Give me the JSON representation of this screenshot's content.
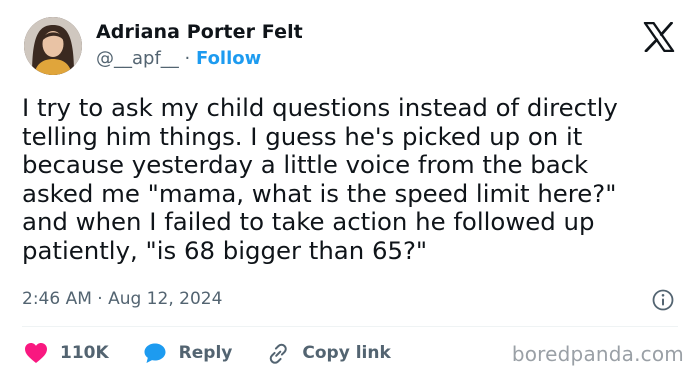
{
  "author": {
    "name": "Adriana Porter Felt",
    "handle": "@__apf__",
    "separator": "·",
    "follow_label": "Follow"
  },
  "tweet": {
    "text": "I try to ask my child questions instead of directly\ntelling him things. I guess he's picked up on it\nbecause yesterday a little voice from the back\nasked me \"mama, what is the speed limit here?\"\nand when I failed to take action he followed up\npatiently, \"is 68 bigger than 65?\"",
    "timestamp": "2:46 AM · Aug 12, 2024"
  },
  "actions": {
    "likes": "110K",
    "reply_label": "Reply",
    "copy_link_label": "Copy link"
  },
  "icons": {
    "platform": "x-logo-icon",
    "info": "info-icon",
    "like": "heart-icon",
    "reply": "speech-bubble-icon",
    "copy_link": "link-icon"
  },
  "colors": {
    "like": "#f91880",
    "reply": "#1d9bf0",
    "follow": "#1d9bf0",
    "muted": "#536471"
  },
  "watermark": "boredpanda.com"
}
